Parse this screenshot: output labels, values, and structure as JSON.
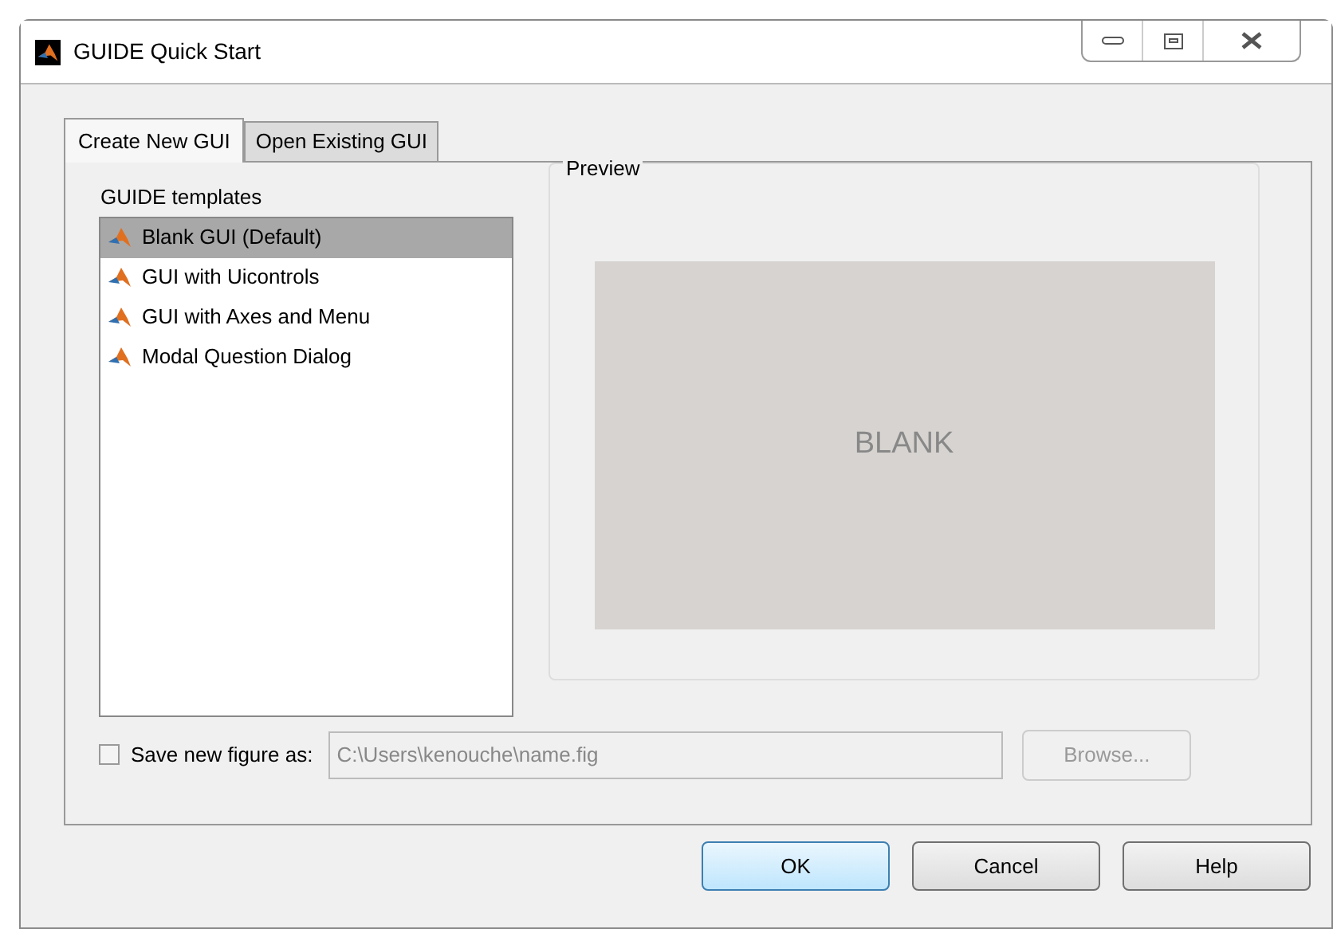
{
  "window": {
    "title": "GUIDE Quick Start"
  },
  "tabs": [
    {
      "label": "Create New GUI",
      "selected": true
    },
    {
      "label": "Open Existing GUI",
      "selected": false
    }
  ],
  "templates": {
    "label": "GUIDE templates",
    "items": [
      {
        "label": "Blank GUI (Default)",
        "selected": true
      },
      {
        "label": "GUI with Uicontrols",
        "selected": false
      },
      {
        "label": "GUI with Axes and Menu",
        "selected": false
      },
      {
        "label": "Modal Question Dialog",
        "selected": false
      }
    ]
  },
  "preview": {
    "label": "Preview",
    "text": "BLANK"
  },
  "save": {
    "label": "Save new figure as:",
    "checked": false,
    "value": "C:\\Users\\kenouche\\name.fig",
    "browse": "Browse...",
    "disabled": true
  },
  "buttons": [
    {
      "label": "OK",
      "default": true
    },
    {
      "label": "Cancel",
      "default": false
    },
    {
      "label": "Help",
      "default": false
    }
  ]
}
